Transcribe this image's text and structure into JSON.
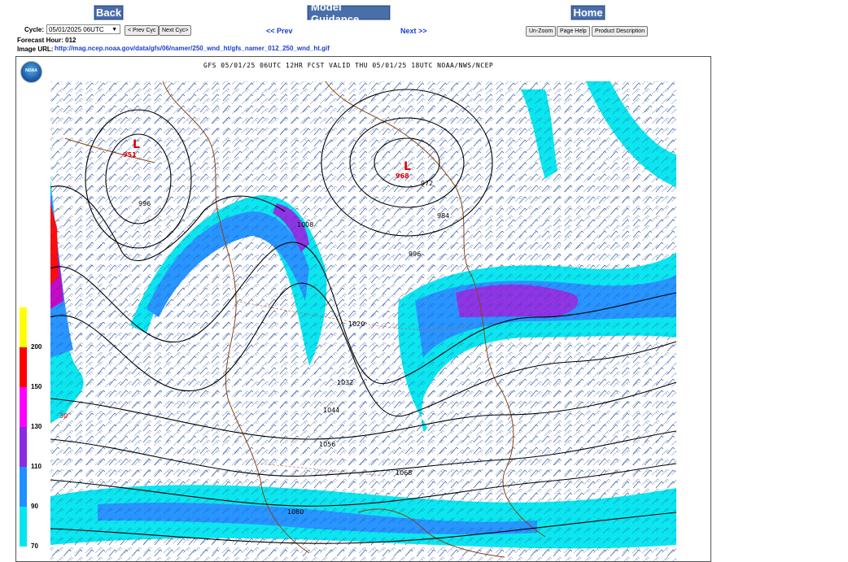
{
  "nav": {
    "back_label": "Back",
    "model_guidance_label": "Model Guidance",
    "home_label": "Home"
  },
  "cycle": {
    "label": "Cycle:",
    "selected": "05/01/2025 06UTC",
    "prev_cyc": "< Prev Cyc",
    "next_cyc": "Next Cyc>"
  },
  "pager": {
    "prev": "<< Prev",
    "next": "Next >>"
  },
  "tools": {
    "unzoom": "Un-Zoom",
    "page_help": "Page Help",
    "product_description": "Product Description"
  },
  "forecast": {
    "label": "Forecast Hour: 012"
  },
  "image_url": {
    "label": "Image URL:",
    "url": "http://mag.ncep.noaa.gov/data/gfs/06/namer/250_wnd_ht/gfs_namer_012_250_wnd_ht.gif"
  },
  "map": {
    "title": "GFS 05/01/25 06UTC 12HR FCST VALID THU 05/01/25 18UTC NOAA/NWS/NCEP",
    "logo_text": "NOAA",
    "lows": [
      {
        "letter": "L",
        "value": "951"
      },
      {
        "letter": "L",
        "value": "968"
      }
    ],
    "contour_labels": [
      "996",
      "1008",
      "1020",
      "1032",
      "1044",
      "1056",
      "1068",
      "1080",
      "972",
      "984",
      "996",
      "30"
    ],
    "legend": {
      "values": [
        "200",
        "150",
        "130",
        "110",
        "90",
        "70"
      ],
      "colors": [
        "#ffff00",
        "#ff0000",
        "#ff00ff",
        "#8a2be2",
        "#1e90ff",
        "#00e5ee"
      ]
    }
  }
}
